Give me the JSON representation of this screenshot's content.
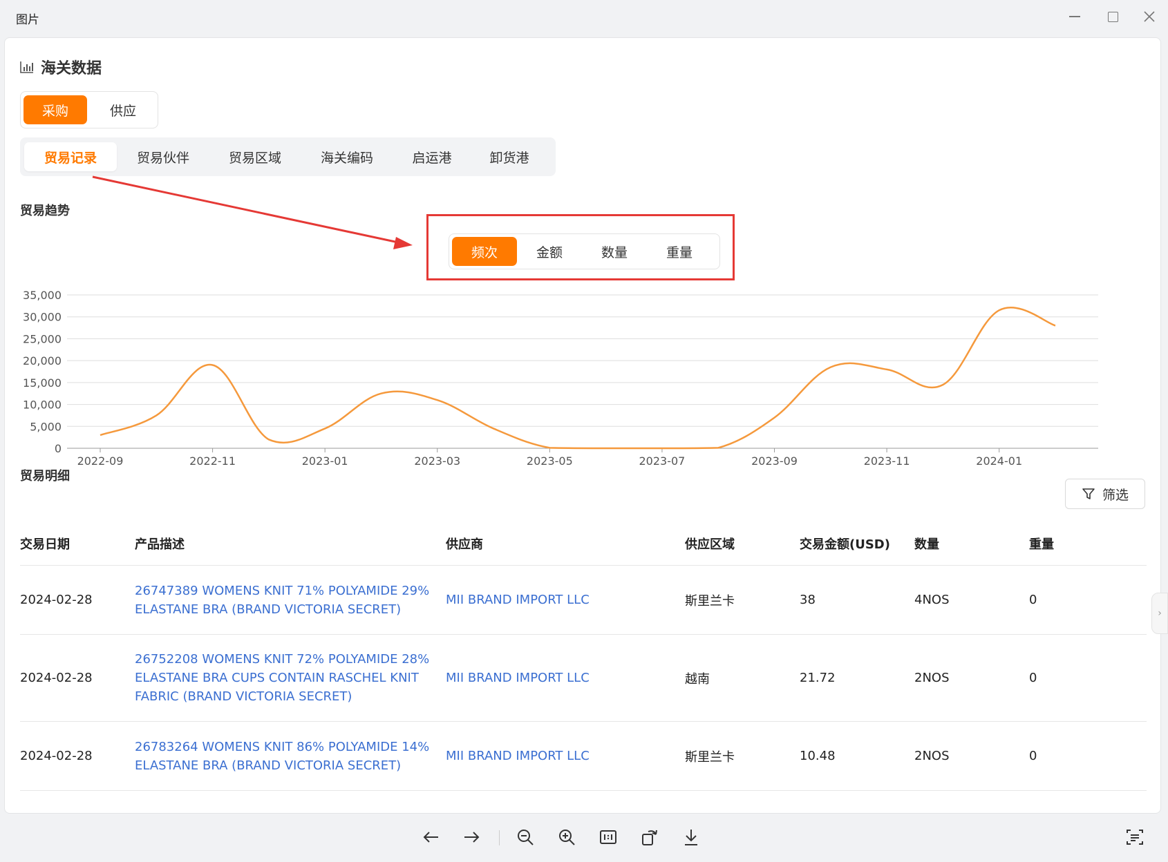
{
  "window": {
    "title": "图片"
  },
  "header": {
    "title": "海关数据",
    "icon": "bar-chart-icon"
  },
  "mode_toggle": {
    "options": [
      "采购",
      "供应"
    ],
    "selected": "采购"
  },
  "category_tabs": {
    "items": [
      "贸易记录",
      "贸易伙伴",
      "贸易区域",
      "海关编码",
      "启运港",
      "卸货港"
    ],
    "selected": "贸易记录"
  },
  "trend": {
    "title": "贸易趋势",
    "metrics": [
      "频次",
      "金额",
      "数量",
      "重量"
    ],
    "selected_metric": "频次"
  },
  "chart_data": {
    "type": "line",
    "x": [
      "2022-09",
      "2022-10",
      "2022-11",
      "2022-12",
      "2023-01",
      "2023-02",
      "2023-03",
      "2023-04",
      "2023-05",
      "2023-06",
      "2023-07",
      "2023-08",
      "2023-09",
      "2023-10",
      "2023-11",
      "2023-12",
      "2024-01",
      "2024-02"
    ],
    "x_tick_labels": [
      "2022-09",
      "2022-11",
      "2023-01",
      "2023-03",
      "2023-05",
      "2023-07",
      "2023-09",
      "2023-11",
      "2024-01"
    ],
    "series": [
      {
        "values": [
          3000,
          7500,
          19000,
          2000,
          4500,
          12500,
          11000,
          4500,
          100,
          0,
          0,
          100,
          7000,
          18500,
          18000,
          14500,
          31500,
          28000
        ]
      }
    ],
    "ylim": [
      0,
      35000
    ],
    "y_ticks": [
      "0",
      "5,000",
      "10,000",
      "15,000",
      "20,000",
      "25,000",
      "30,000",
      "35,000"
    ],
    "grid": true,
    "color": "#f5993c"
  },
  "detail": {
    "title": "贸易明细",
    "filter_label": "筛选",
    "columns": [
      "交易日期",
      "产品描述",
      "供应商",
      "供应区域",
      "交易金额(USD)",
      "数量",
      "重量"
    ],
    "rows": [
      {
        "date": "2024-02-28",
        "desc": "26747389 WOMENS KNIT 71% POLYAMIDE 29% ELASTANE BRA (BRAND VICTORIA SECRET)",
        "supplier": "MII BRAND IMPORT LLC",
        "region": "斯里兰卡",
        "amount": "38",
        "qty": "4NOS",
        "weight": "0"
      },
      {
        "date": "2024-02-28",
        "desc": "26752208 WOMENS KNIT 72% POLYAMIDE 28% ELASTANE BRA CUPS CONTAIN RASCHEL KNIT FABRIC (BRAND VICTORIA SECRET)",
        "supplier": "MII BRAND IMPORT LLC",
        "region": "越南",
        "amount": "21.72",
        "qty": "2NOS",
        "weight": "0"
      },
      {
        "date": "2024-02-28",
        "desc": "26783264 WOMENS KNIT 86% POLYAMIDE 14% ELASTANE BRA (BRAND VICTORIA SECRET)",
        "supplier": "MII BRAND IMPORT LLC",
        "region": "斯里兰卡",
        "amount": "10.48",
        "qty": "2NOS",
        "weight": "0"
      }
    ]
  },
  "colors": {
    "accent": "#ff7a00",
    "link": "#3b6fd1",
    "annotation": "#e53935",
    "line": "#f5993c"
  }
}
